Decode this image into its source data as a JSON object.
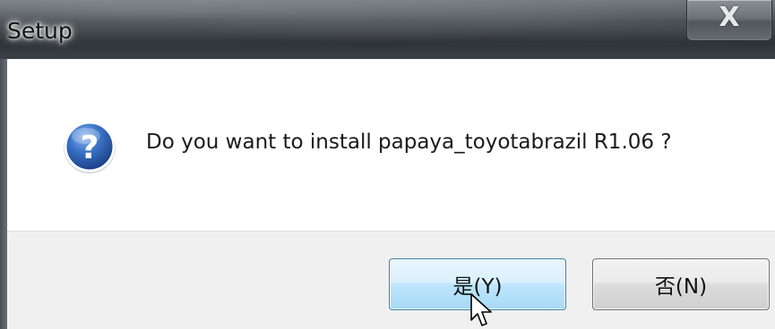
{
  "window": {
    "title": "Setup",
    "close_glyph": "X"
  },
  "dialog": {
    "icon": "question-icon",
    "message": "Do you want to install papaya_toyotabrazil R1.06 ?"
  },
  "buttons": {
    "yes_label": "是(Y)",
    "no_label": "否(N)"
  },
  "colors": {
    "titlebar": "#3d4349",
    "button_bar": "#f0f0f0",
    "default_button_border": "#3c7fb1",
    "question_icon": "#2a5fb0"
  }
}
